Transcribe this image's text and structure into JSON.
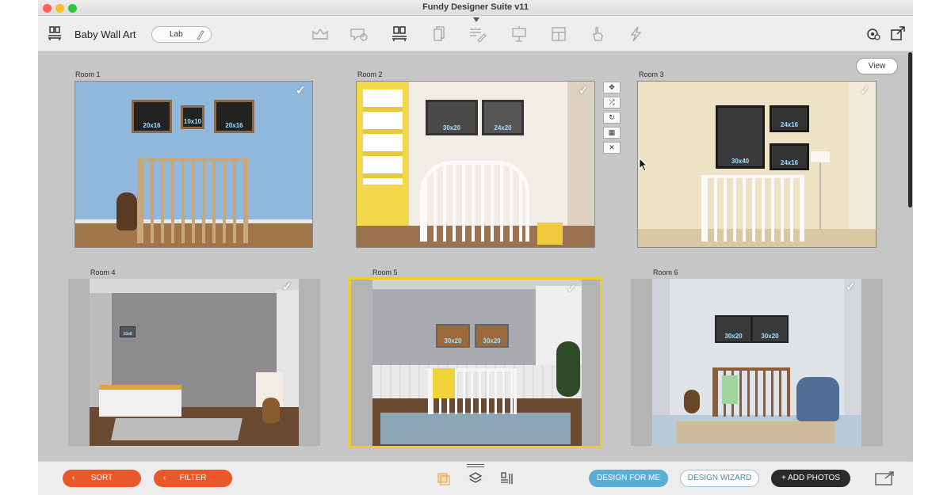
{
  "window": {
    "title": "Fundy Designer Suite v11"
  },
  "toolbar": {
    "project_name": "Baby Wall Art",
    "lab_label": "Lab",
    "tools": [
      "album-icon",
      "speech-bubble-icon",
      "wall-art-icon",
      "cards-icon",
      "text-edit-icon",
      "presentation-icon",
      "grid-layout-icon",
      "hand-touch-icon",
      "lightning-icon"
    ]
  },
  "view_button": "View",
  "rooms": [
    {
      "label": "Room 1",
      "sizes": [
        "20x16",
        "10x10",
        "20x16"
      ],
      "wall": "#8fb8dc"
    },
    {
      "label": "Room 2",
      "sizes": [
        "30x20",
        "24x20"
      ],
      "wall": "#f1ece4"
    },
    {
      "label": "Room 3",
      "sizes": [
        "30x40",
        "24x16",
        "24x16"
      ],
      "wall": "#ede2c4"
    },
    {
      "label": "Room 4",
      "sizes": [
        "10x8"
      ],
      "wall": "#8c8c8e"
    },
    {
      "label": "Room 5",
      "sizes": [
        "30x20",
        "30x20"
      ],
      "wall": "#a9abb0"
    },
    {
      "label": "Room 6",
      "sizes": [
        "30x20",
        "30x20"
      ],
      "wall": "#dfe2e6"
    }
  ],
  "selected_room": "Room 5",
  "bottombar": {
    "sort_label": "SORT",
    "filter_label": "FILTER",
    "design_for_me": "DESIGN FOR ME",
    "design_wizard": "DESIGN WIZARD",
    "add_photos": "+ ADD PHOTOS"
  },
  "colors": {
    "accent_orange": "#e8582b",
    "accent_blue": "#5aaed4",
    "selection_yellow": "#f1cb2a"
  }
}
